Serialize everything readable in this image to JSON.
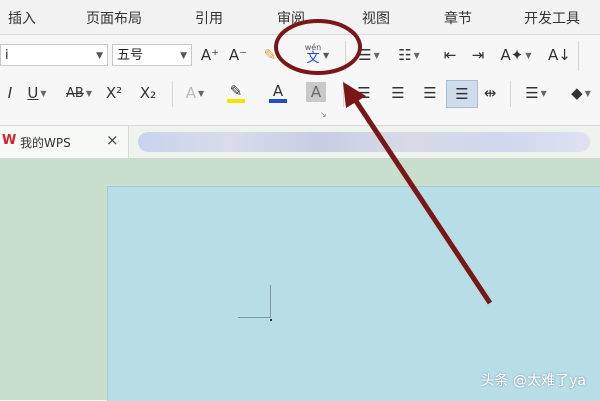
{
  "menu": [
    "插入",
    "页面布局",
    "引用",
    "审阅",
    "视图",
    "章节",
    "开发工具"
  ],
  "font": {
    "name_value": "i",
    "size_value": "五号"
  },
  "ribbon": {
    "grow_font": "A⁺",
    "shrink_font": "A⁻",
    "phonetic_top": "wén",
    "phonetic_bottom": "文",
    "underline": "U",
    "strike": "AB",
    "superscript": "X²",
    "subscript": "X₂",
    "text_effect": "A",
    "font_color": "A",
    "char_shading": "A"
  },
  "tab": {
    "label": "我的WPS",
    "close": "×"
  },
  "watermark": "头条 @太难了ya",
  "colors": {
    "annotation": "#7a1518",
    "font_color_bar": "#1f4dd1",
    "highlight_bar": "#f2e600",
    "doc_bg": "#b7dde7"
  }
}
